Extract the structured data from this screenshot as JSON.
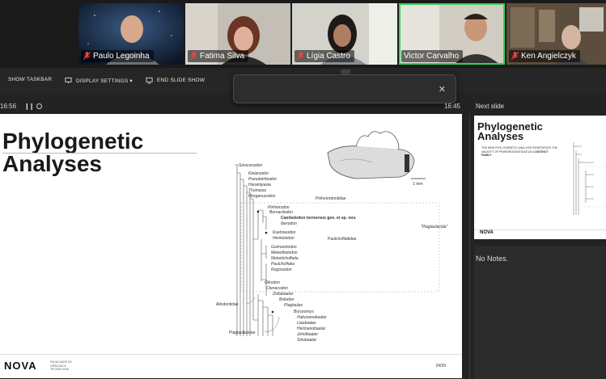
{
  "participants": [
    {
      "name": "Paulo Legoinha",
      "bg": "#1d2b3d"
    },
    {
      "name": "Fatima Silva",
      "bg": "#bfbab2"
    },
    {
      "name": "Lígia Castro",
      "bg": "#c9c9c2"
    },
    {
      "name": "Victor Carvalho",
      "bg": "#c8c3b8",
      "active": true
    },
    {
      "name": "Ken Angielczyk",
      "bg": "#6a5a48"
    }
  ],
  "toolbar": {
    "show_taskbar": "SHOW TASKBAR",
    "display_settings": "DISPLAY SETTINGS ▾",
    "end_slide_show": "END SLIDE SHOW"
  },
  "presenter": {
    "elapsed": "16:56",
    "clock": "16:45",
    "next_slide_label": "Next slide",
    "notes": "No Notes."
  },
  "slide": {
    "title_line1": "Phylogenetic",
    "title_line2": "Analyses",
    "logo": "NOVA",
    "logo_sub": "FACULDADE DE CIÊNCIAS E TECNOLOGIA",
    "page": "24/39",
    "scale_label": "1 mm",
    "taxa": [
      "Sinoconodon",
      "Kielanodon",
      "Pseudotribodon",
      "Haramiyavia",
      "Thomasia",
      "Morganucodon",
      "Pinheirodon",
      "Bernardodon",
      "Cambelodon torreensis gen. et sp. nov.",
      "Iberodon",
      "Kuehneodon",
      "Henkelodon",
      "Guimarotodon",
      "Meketibolodon",
      "Meketichoffatia",
      "Paulchoffatia",
      "Rugosodon",
      "Glirodon",
      "Ctenacodon",
      "Zofiabaatar",
      "Bolodon",
      "Plagiaulax",
      "Bryceomys",
      "Hakusanobaatar",
      "Liaobaatar",
      "Heishanobaatar",
      "Jeholbaatar",
      "Sinobaatar"
    ],
    "groups": [
      "Pinheirodontidae",
      "Paulchoffatiidae",
      "\"Plagiaulacida\"",
      "Allodontidae",
      "Plagiaulacidae"
    ]
  },
  "next_slide": {
    "title_line1": "Phylogenetic",
    "title_line2": "Analyses",
    "text_pre": "THE NEW PHYLOGENETIC ANALYSIS REINFORCES THE VALIDITY OF PINHEIRODONTIDAE AS A",
    "text_bold": "DISTINCT FAMILY",
    "logo": "NOVA"
  }
}
